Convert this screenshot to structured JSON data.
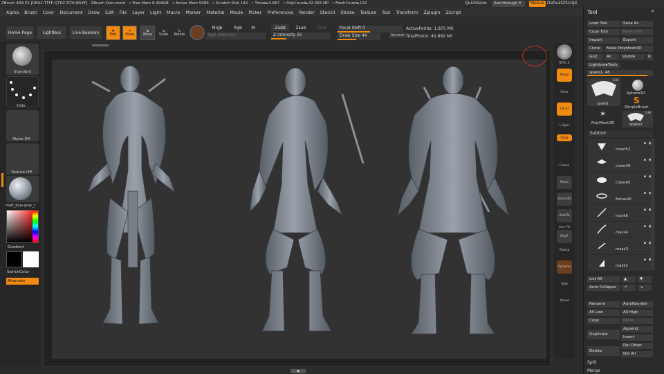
{
  "titlebar": {
    "app": "ZBrush 4R8 P2 [DEUC-TTFF-QTRZ-TDYI-NSXF]",
    "doc": "ZBrush Document",
    "free_mem": "• Free Mem 8.494GB",
    "active_mem": "• Active Mem 5089",
    "scratch": "• Scratch Disk 144",
    "timer": "• Timer►4.867",
    "polycount": "• PolyCount►42.356 MP",
    "meshcount": "• MeshCount►132",
    "quicksave": "QuickSave",
    "seethrough": "See-through  0",
    "menus": "Menus",
    "defaultscript": "DefaultZScript"
  },
  "menubar": {
    "items": [
      "Alpha",
      "Brush",
      "Color",
      "Document",
      "Draw",
      "Edit",
      "File",
      "Layer",
      "Light",
      "Macro",
      "Marker",
      "Material",
      "Movie",
      "Picker",
      "Preferences",
      "Render",
      "Stencil",
      "Stroke",
      "Texture",
      "Tool",
      "Transform",
      "Zplugin",
      "Zscript"
    ]
  },
  "toolbar": {
    "home_page": "Home Page",
    "lightbox": "LightBox",
    "live_boolean": "Live Boolean",
    "edit": "Edit",
    "draw": "Draw",
    "move": "Move",
    "scale": "Scale",
    "rotate": "Rotate",
    "mrgb": "Mrgb",
    "rgb": "Rgb",
    "m": "M",
    "rgb_intensity": "Rgb Intensity",
    "zadd": "Zadd",
    "zsub": "Zsub",
    "zcut": "Zcut",
    "z_intensity": "Z Intensity 25",
    "z_intensity_value": 0.25,
    "focal_shift": "Focal Shift 0",
    "focal_shift_value": 0.5,
    "draw_size": "Draw Size 44",
    "draw_size_value": 0.44,
    "dynamic": "Dynamic",
    "active_points": "ActivePoints: 1.875 Mil",
    "total_points": "TotalPoints: 45.892 Mil"
  },
  "left_shelf": {
    "standard": "Standard",
    "dots": "Dots",
    "alpha_off": "Alpha Off",
    "texture_off": "Texture Off",
    "material": "matt_blue-gray_c",
    "gradient": "Gradient",
    "switch_color": "SwitchColor",
    "alternate": "Alternate"
  },
  "right_shelf": {
    "bpr": "BPR",
    "spix": "SPix  3",
    "persp": "Persp",
    "floor": "Floor",
    "local": "Local",
    "lsym": "L.Sym",
    "xyz": "Qxyz",
    "frame": "Frame",
    "move": "Move",
    "zoom3d": "Zoom3D",
    "rotate": "RotaTe",
    "line_fill": "Line Fill",
    "polyf": "PolyF",
    "transp": "Transp",
    "dynamic": "Dynamic",
    "solo": "Solo",
    "xpose": "Xpose"
  },
  "tool_panel": {
    "title": "Tool",
    "load_tool": "Load Tool",
    "save_as": "Save As",
    "copy_tool": "Copy Tool",
    "paste_tool": "Paste Tool",
    "import": "Import",
    "export": "Export",
    "clone": "Clone",
    "make_polymesh": "Make PolyMesh3D",
    "goz": "GoZ",
    "all": "All",
    "visible": "Visible",
    "r": "R",
    "lightbox_tools": "Lightbox▸Tools",
    "spare_slider": "spare1. 48",
    "thumbs": [
      {
        "label": "spare1",
        "count": "138"
      },
      {
        "label": "Sphere3D",
        "count": ""
      },
      {
        "label": "SimpleBrush",
        "count": ""
      },
      {
        "label": "PolyMesh3D",
        "count": ""
      },
      {
        "label": "spare1",
        "count": "138"
      }
    ],
    "subtool_title": "Subtool",
    "subtools": [
      "chest52",
      "chest49",
      "chest45",
      "Extract0",
      "mask6",
      "mask4",
      "mask3",
      "mask2"
    ],
    "list_all": "List All",
    "auto_collapse": "Auto Collapse",
    "rename": "Rename",
    "auto_reorder": "AutoReorder",
    "all_low": "All Low",
    "all_high": "All High",
    "copy": "Copy",
    "paste": "Paste",
    "append": "Append",
    "duplicate": "Duplicate",
    "insert": "Insert",
    "delete": "Delete",
    "del_other": "Del Other",
    "del_all": "Del All",
    "split": "Split",
    "merge": "Merge"
  },
  "colors": {
    "accent": "#f08a10",
    "canvas": "#323232",
    "panel": "#2b2b2b",
    "model": "#8a9098"
  }
}
